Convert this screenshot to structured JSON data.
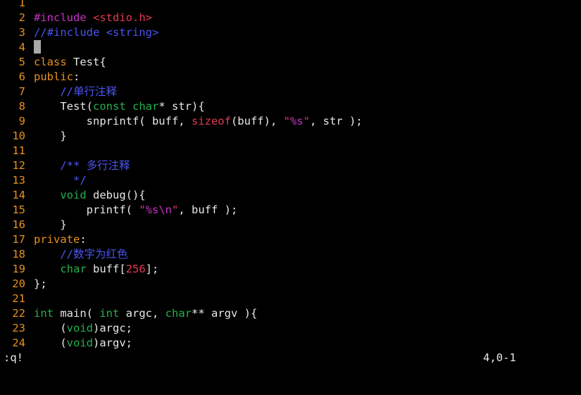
{
  "colors": {
    "background": "#000000",
    "line_number": "#e8911f",
    "keyword": "#e8911f",
    "type": "#22b24c",
    "preprocessor": "#c533c5",
    "string": "#e33a55",
    "comment": "#4b55f0",
    "text": "#e8e8e8",
    "cursor": "#a8a8a8"
  },
  "editor": {
    "lines": [
      {
        "n": "1",
        "segs": []
      },
      {
        "n": "2",
        "segs": [
          {
            "t": "#include ",
            "c": "pre"
          },
          {
            "t": "<stdio.h>",
            "c": "str"
          }
        ]
      },
      {
        "n": "3",
        "segs": [
          {
            "t": "//#include <string>",
            "c": "cmt"
          }
        ]
      },
      {
        "n": "4",
        "cursor": true,
        "segs": []
      },
      {
        "n": "5",
        "segs": [
          {
            "t": "class",
            "c": "kw"
          },
          {
            "t": " Test{",
            "c": "plain"
          }
        ]
      },
      {
        "n": "6",
        "segs": [
          {
            "t": "public",
            "c": "kw"
          },
          {
            "t": ":",
            "c": "plain"
          }
        ]
      },
      {
        "n": "7",
        "segs": [
          {
            "t": "    ",
            "c": "plain"
          },
          {
            "t": "//单行注释",
            "c": "cmt"
          }
        ]
      },
      {
        "n": "8",
        "segs": [
          {
            "t": "    Test(",
            "c": "plain"
          },
          {
            "t": "const",
            "c": "type"
          },
          {
            "t": " ",
            "c": "plain"
          },
          {
            "t": "char",
            "c": "type"
          },
          {
            "t": "* str){",
            "c": "plain"
          }
        ]
      },
      {
        "n": "9",
        "segs": [
          {
            "t": "        snprintf( buff, ",
            "c": "plain"
          },
          {
            "t": "sizeof",
            "c": "fn"
          },
          {
            "t": "(buff), ",
            "c": "plain"
          },
          {
            "t": "\"",
            "c": "str"
          },
          {
            "t": "%s",
            "c": "esc"
          },
          {
            "t": "\"",
            "c": "str"
          },
          {
            "t": ", str );",
            "c": "plain"
          }
        ]
      },
      {
        "n": "10",
        "segs": [
          {
            "t": "    }",
            "c": "plain"
          }
        ]
      },
      {
        "n": "11",
        "segs": []
      },
      {
        "n": "12",
        "segs": [
          {
            "t": "    ",
            "c": "plain"
          },
          {
            "t": "/** 多行注释",
            "c": "cmt"
          }
        ]
      },
      {
        "n": "13",
        "segs": [
          {
            "t": "      ",
            "c": "plain"
          },
          {
            "t": "*/",
            "c": "cmt"
          }
        ]
      },
      {
        "n": "14",
        "segs": [
          {
            "t": "    ",
            "c": "plain"
          },
          {
            "t": "void",
            "c": "type"
          },
          {
            "t": " debug(){",
            "c": "plain"
          }
        ]
      },
      {
        "n": "15",
        "segs": [
          {
            "t": "        printf( ",
            "c": "plain"
          },
          {
            "t": "\"",
            "c": "str"
          },
          {
            "t": "%s\\n",
            "c": "esc"
          },
          {
            "t": "\"",
            "c": "str"
          },
          {
            "t": ", buff );",
            "c": "plain"
          }
        ]
      },
      {
        "n": "16",
        "segs": [
          {
            "t": "    }",
            "c": "plain"
          }
        ]
      },
      {
        "n": "17",
        "segs": [
          {
            "t": "private",
            "c": "kw"
          },
          {
            "t": ":",
            "c": "plain"
          }
        ]
      },
      {
        "n": "18",
        "segs": [
          {
            "t": "    ",
            "c": "plain"
          },
          {
            "t": "//数字为红色",
            "c": "cmt"
          }
        ]
      },
      {
        "n": "19",
        "segs": [
          {
            "t": "    ",
            "c": "plain"
          },
          {
            "t": "char",
            "c": "type"
          },
          {
            "t": " buff[",
            "c": "plain"
          },
          {
            "t": "256",
            "c": "num"
          },
          {
            "t": "];",
            "c": "plain"
          }
        ]
      },
      {
        "n": "20",
        "segs": [
          {
            "t": "};",
            "c": "plain"
          }
        ]
      },
      {
        "n": "21",
        "segs": []
      },
      {
        "n": "22",
        "segs": [
          {
            "t": "int",
            "c": "type"
          },
          {
            "t": " main( ",
            "c": "plain"
          },
          {
            "t": "int",
            "c": "type"
          },
          {
            "t": " argc, ",
            "c": "plain"
          },
          {
            "t": "char",
            "c": "type"
          },
          {
            "t": "** argv ){",
            "c": "plain"
          }
        ]
      },
      {
        "n": "23",
        "segs": [
          {
            "t": "    (",
            "c": "plain"
          },
          {
            "t": "void",
            "c": "type"
          },
          {
            "t": ")argc;",
            "c": "plain"
          }
        ]
      },
      {
        "n": "24",
        "segs": [
          {
            "t": "    (",
            "c": "plain"
          },
          {
            "t": "void",
            "c": "type"
          },
          {
            "t": ")argv;",
            "c": "plain"
          }
        ]
      }
    ]
  },
  "statusbar": {
    "command": ":q!",
    "ruler": "4,0-1"
  }
}
